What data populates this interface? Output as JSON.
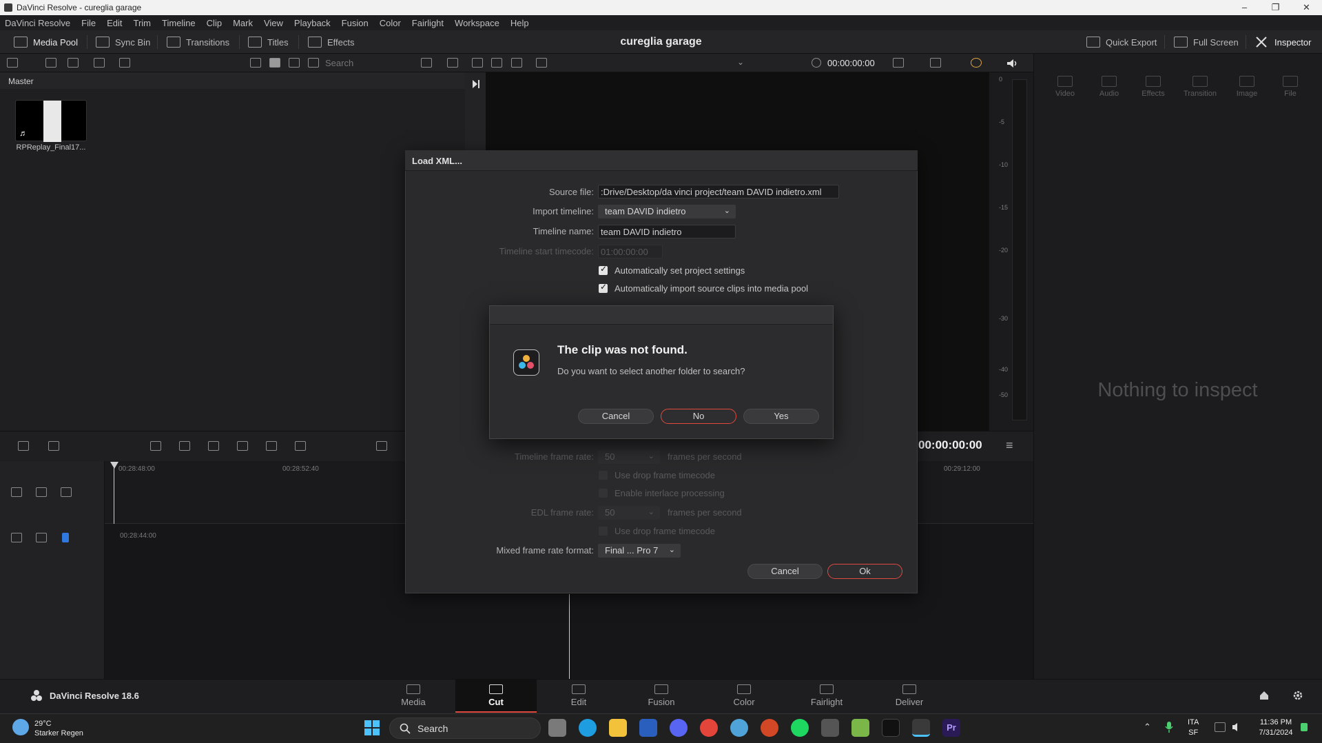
{
  "window": {
    "title": "DaVinci Resolve - cureglia garage",
    "min": "–",
    "max": "❐",
    "close": "✕"
  },
  "menu": [
    "DaVinci Resolve",
    "File",
    "Edit",
    "Trim",
    "Timeline",
    "Clip",
    "Mark",
    "View",
    "Playback",
    "Fusion",
    "Color",
    "Fairlight",
    "Workspace",
    "Help"
  ],
  "toolbar": {
    "media_pool": "Media Pool",
    "sync_bin": "Sync Bin",
    "transitions": "Transitions",
    "titles": "Titles",
    "effects": "Effects",
    "project_title": "cureglia garage",
    "quick_export": "Quick Export",
    "full_screen": "Full Screen",
    "inspector": "Inspector"
  },
  "subbar": {
    "search_placeholder": "Search",
    "timecode": "00:00:00:00"
  },
  "media_pool": {
    "bin": "Master",
    "clip_name": "RPReplay_Final17..."
  },
  "meter": {
    "labels": [
      "0",
      "-5",
      "-10",
      "-15",
      "-20",
      "-30",
      "-40",
      "-50"
    ]
  },
  "inspector": {
    "tabs": [
      "Video",
      "Audio",
      "Effects",
      "Transition",
      "Image",
      "File"
    ],
    "empty": "Nothing to inspect"
  },
  "timeline": {
    "tc_upper": [
      "00:28:48:00",
      "00:28:52:40",
      "00:29:12:00"
    ],
    "tc_lower": "00:28:44:00",
    "timecode": "00:00:00:00"
  },
  "load_xml": {
    "title": "Load XML...",
    "source_file_label": "Source file:",
    "source_file_value": ":Drive/Desktop/da  vinci project/team DAVID indietro.xml",
    "import_timeline_label": "Import timeline:",
    "import_timeline_value": "team DAVID indietro",
    "timeline_name_label": "Timeline name:",
    "timeline_name_value": "team DAVID indietro",
    "start_tc_label": "Timeline start timecode:",
    "start_tc_value": "01:00:00:00",
    "auto_project_settings": "Automatically set project settings",
    "auto_import_clips": "Automatically import source clips into media pool",
    "frame_rate_label": "Timeline frame rate:",
    "frame_rate_value": "50",
    "fps": "frames per second",
    "drop_frame": "Use drop frame timecode",
    "interlace": "Enable interlace processing",
    "edl_rate_label": "EDL frame rate:",
    "edl_rate_value": "50",
    "edl_fps": "frames per second",
    "edl_drop_frame": "Use drop frame timecode",
    "mixed_label": "Mixed frame rate format:",
    "mixed_value": "Final ... Pro 7",
    "cancel": "Cancel",
    "ok": "Ok"
  },
  "alert": {
    "title": "The clip was not found.",
    "message": "Do you want to select another folder to search?",
    "cancel": "Cancel",
    "no": "No",
    "yes": "Yes"
  },
  "pages": [
    "Media",
    "Cut",
    "Edit",
    "Fusion",
    "Color",
    "Fairlight",
    "Deliver"
  ],
  "brand": "DaVinci Resolve 18.6",
  "taskbar": {
    "temp": "29°C",
    "weather": "Starker Regen",
    "search": "Search",
    "lang1": "ITA",
    "lang2": "SF",
    "time": "11:36 PM",
    "date": "7/31/2024"
  }
}
